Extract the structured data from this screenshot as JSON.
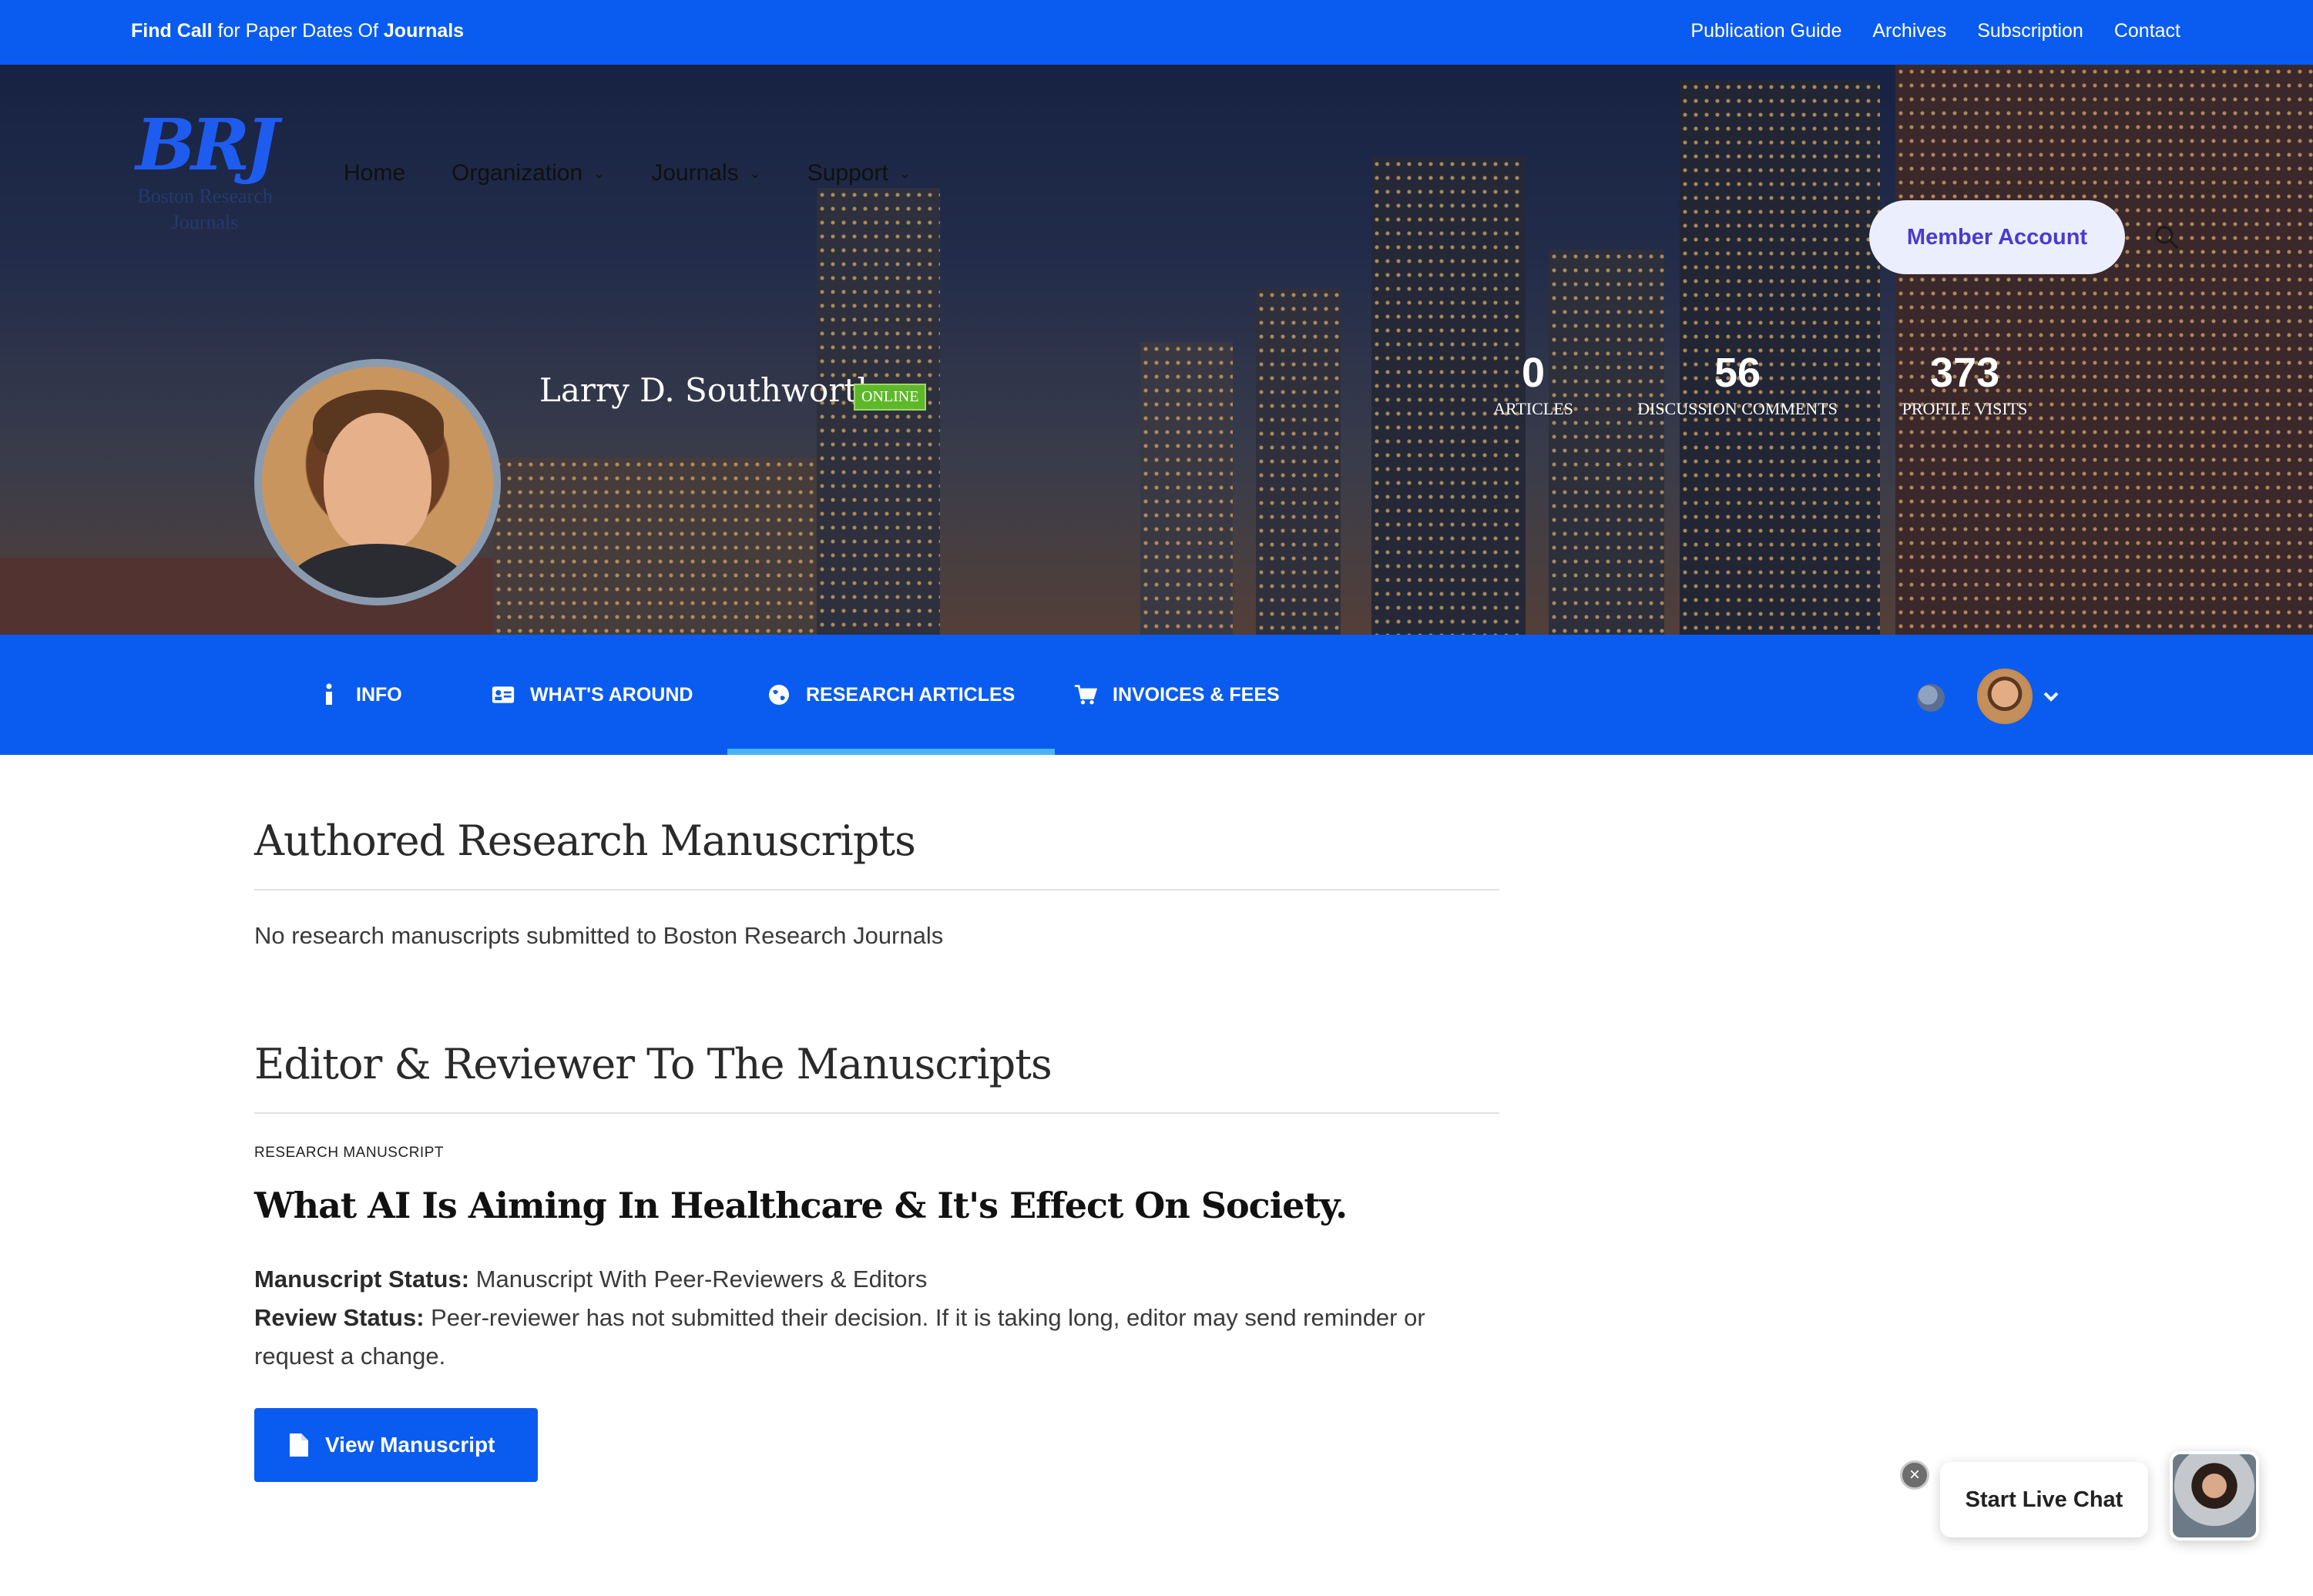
{
  "topbar": {
    "promo_prefix": "Find Call",
    "promo_middle": " for Paper Dates Of ",
    "promo_suffix": "Journals",
    "links": [
      "Publication Guide",
      "Archives",
      "Subscription",
      "Contact"
    ]
  },
  "brand": {
    "mark": "BRJ",
    "name_line1": "Boston Research",
    "name_line2": "Journals"
  },
  "nav": {
    "items": [
      {
        "label": "Home"
      },
      {
        "label": "Organization"
      },
      {
        "label": "Journals"
      },
      {
        "label": "Support"
      }
    ],
    "member_button": "Member Account"
  },
  "profile": {
    "name": "Larry D. Southworth",
    "status": "ONLINE",
    "stats": [
      {
        "value": "0",
        "label": "ARTICLES"
      },
      {
        "value": "56",
        "label": "DISCUSSION COMMENTS"
      },
      {
        "value": "373",
        "label": "PROFILE VISITS"
      }
    ]
  },
  "tabs": [
    {
      "label": "INFO",
      "icon": "info-icon"
    },
    {
      "label": "WHAT'S AROUND",
      "icon": "id-card-icon"
    },
    {
      "label": "RESEARCH ARTICLES",
      "icon": "globe-icon",
      "active": true
    },
    {
      "label": "INVOICES & FEES",
      "icon": "cart-icon"
    }
  ],
  "authored": {
    "heading": "Authored Research Manuscripts",
    "empty_text": "No research manuscripts submitted to Boston Research Journals"
  },
  "editor": {
    "heading": "Editor & Reviewer To The Manuscripts",
    "manuscript": {
      "eyebrow": "RESEARCH MANUSCRIPT",
      "title": "What AI Is Aiming In Healthcare & It's Effect On Society.",
      "status_label": "Manuscript Status:",
      "status_value": " Manuscript With Peer-Reviewers & Editors",
      "review_label": "Review Status:",
      "review_value": " Peer-reviewer has not submitted their decision. If it is taking long, editor may send reminder or request a change.",
      "button": "View Manuscript"
    }
  },
  "chat": {
    "label": "Start Live Chat",
    "close": "×"
  },
  "colors": {
    "primary_blue": "#0a5cf0",
    "active_tab_underline": "#4ab3f4",
    "online_green": "#5fb82a",
    "member_button_bg": "#ebeefc",
    "member_button_text": "#4a3ad0"
  }
}
